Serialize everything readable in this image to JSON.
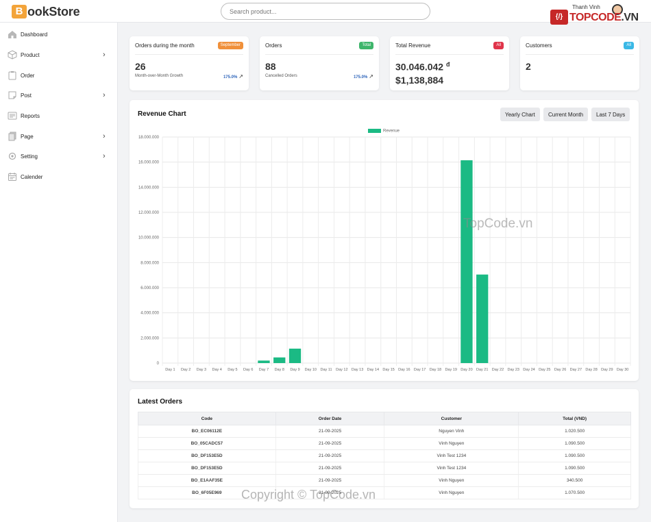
{
  "header": {
    "logo_letter": "B",
    "logo_text": "ookStore",
    "search_placeholder": "Search product...",
    "user_name": "Thanh Vinh",
    "brand_mark": "{/}",
    "brand_name": "TOPCODE",
    "brand_tld": ".VN"
  },
  "sidebar": {
    "items": [
      {
        "label": "Dashboard",
        "icon": "home-icon",
        "has_children": false
      },
      {
        "label": "Product",
        "icon": "box-icon",
        "has_children": true
      },
      {
        "label": "Order",
        "icon": "clipboard-icon",
        "has_children": false
      },
      {
        "label": "Post",
        "icon": "note-icon",
        "has_children": true
      },
      {
        "label": "Reports",
        "icon": "report-icon",
        "has_children": false
      },
      {
        "label": "Page",
        "icon": "pages-icon",
        "has_children": true
      },
      {
        "label": "Setting",
        "icon": "gear-icon",
        "has_children": true
      },
      {
        "label": "Calender",
        "icon": "calendar-icon",
        "has_children": false
      }
    ]
  },
  "stats": {
    "orders_month": {
      "title": "Orders during the month",
      "badge": "September",
      "badge_color": "#f0903a",
      "value": "26",
      "sub": "Month-over-Month Growth",
      "growth": "175.0%"
    },
    "orders": {
      "title": "Orders",
      "badge": "Total",
      "badge_color": "#3eb56b",
      "value": "88",
      "sub": "Cancelled Orders",
      "growth": "175.0%"
    },
    "revenue": {
      "title": "Total Revenue",
      "badge": "All",
      "badge_color": "#e0344a",
      "value_vnd": "30.046.042",
      "currency_symbol": "đ",
      "value_usd": "$1,138,884"
    },
    "customers": {
      "title": "Customers",
      "badge": "All",
      "badge_color": "#3ab8e6",
      "value": "2"
    }
  },
  "revenue_chart": {
    "title": "Revenue Chart",
    "buttons": [
      "Yearly Chart",
      "Current Month",
      "Last 7 Days"
    ]
  },
  "chart_data": {
    "type": "bar",
    "title": "Revenue Chart",
    "categories": [
      "Day 1",
      "Day 2",
      "Day 3",
      "Day 4",
      "Day 5",
      "Day 6",
      "Day 7",
      "Day 8",
      "Day 9",
      "Day 10",
      "Day 11",
      "Day 12",
      "Day 13",
      "Day 14",
      "Day 15",
      "Day 16",
      "Day 17",
      "Day 18",
      "Day 19",
      "Day 20",
      "Day 21",
      "Day 22",
      "Day 23",
      "Day 24",
      "Day 25",
      "Day 26",
      "Day 27",
      "Day 28",
      "Day 29",
      "Day 30"
    ],
    "series": [
      {
        "name": "Revenue",
        "color": "#1bba84",
        "values": [
          0,
          0,
          0,
          0,
          0,
          0,
          200000,
          450000,
          1150000,
          0,
          0,
          0,
          0,
          0,
          0,
          0,
          0,
          0,
          0,
          16150000,
          7050000,
          0,
          0,
          0,
          0,
          0,
          0,
          0,
          0,
          0
        ]
      }
    ],
    "ylim": [
      0,
      18000000
    ],
    "yticks": [
      "0",
      "2.000.000",
      "4.000.000",
      "6.000.000",
      "8.000.000",
      "10.000.000",
      "12.000.000",
      "14.000.000",
      "16.000.000",
      "18.000.000"
    ],
    "grid": true,
    "legend": "top-center"
  },
  "latest_orders": {
    "title": "Latest Orders",
    "columns": [
      "Code",
      "Order Date",
      "Customer",
      "Total (VND)"
    ],
    "rows": [
      [
        "BO_EC06112E",
        "21-09-2025",
        "Nguyen Vinh",
        "1.020.500"
      ],
      [
        "BO_05CADC57",
        "21-09-2025",
        "Vinh Nguyen",
        "1.090.500"
      ],
      [
        "BO_DF153E5D",
        "21-09-2025",
        "Vinh Test 1234",
        "1.090.500"
      ],
      [
        "BO_DF153E5D",
        "21-09-2025",
        "Vinh Test 1234",
        "1.090.500"
      ],
      [
        "BO_E1AAF35E",
        "21-09-2025",
        "Vinh Nguyen",
        "340.500"
      ],
      [
        "BO_6F05E969",
        "21-09-2025",
        "Vinh Nguyen",
        "1.070.500"
      ]
    ]
  },
  "watermarks": {
    "chart": "TopCode.vn",
    "footer": "Copyright © TopCode.vn"
  }
}
